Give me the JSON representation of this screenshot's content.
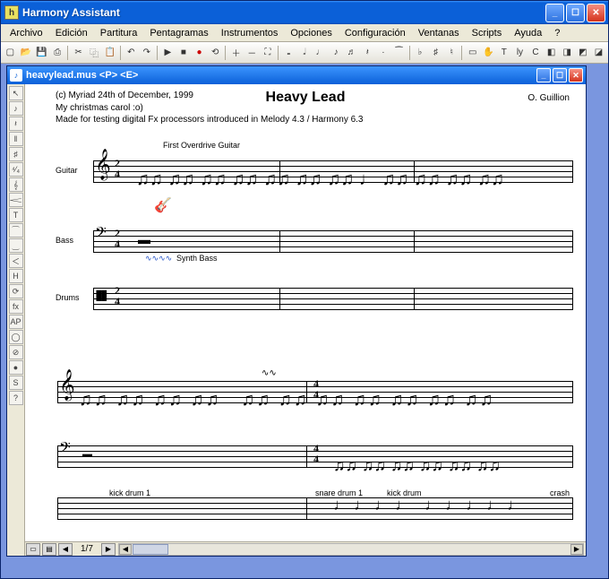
{
  "app": {
    "title": "Harmony Assistant",
    "icon_label": "h"
  },
  "menu": [
    "Archivo",
    "Edición",
    "Partitura",
    "Pentagramas",
    "Instrumentos",
    "Opciones",
    "Configuración",
    "Ventanas",
    "Scripts",
    "Ayuda",
    "?"
  ],
  "toolbar_icons": [
    "new",
    "open",
    "save",
    "print",
    "|",
    "cut",
    "copy",
    "paste",
    "|",
    "undo",
    "redo",
    "|",
    "play",
    "stop",
    "rec",
    "loop",
    "|",
    "zoom-in",
    "zoom-out",
    "fit",
    "|",
    "note-whole",
    "note-half",
    "note-quarter",
    "note-8th",
    "note-16th",
    "note-32nd",
    "rest",
    "dot",
    "tie",
    "|",
    "flat",
    "sharp",
    "natural",
    "|",
    "sel",
    "hand",
    "text",
    "lyrics",
    "chord",
    "|",
    "a",
    "b",
    "c",
    "d",
    "e"
  ],
  "palette_icons": [
    "arrow",
    "note",
    "rest",
    "bar",
    "key",
    "time",
    "clef",
    "dyn",
    "txt",
    "tie",
    "slur",
    "hair",
    "H",
    "rep",
    "fx",
    "AP",
    "loop",
    "mute",
    "rec",
    "S",
    "?"
  ],
  "document": {
    "title": "heavylead.mus  <P>  <E>",
    "icon_glyph": "♪"
  },
  "score": {
    "title": "Heavy Lead",
    "composer": "O. Guillion",
    "credit_line1": "(c) Myriad 24th of December, 1999",
    "credit_line2": "My christmas carol :o)",
    "credit_line3": "Made for testing digital Fx processors introduced in Melody 4.3 / Harmony 6.3",
    "annotation_guitar": "First Overdrive Guitar",
    "annotation_bass": "Synth Bass",
    "staves": [
      {
        "label": "Guitar",
        "clef": "𝄞",
        "time_top": "2",
        "time_bot": "4"
      },
      {
        "label": "Bass",
        "clef": "𝄢",
        "time_top": "2",
        "time_bot": "4"
      },
      {
        "label": "Drums",
        "clef": "||",
        "time_top": "2",
        "time_bot": "4"
      }
    ],
    "drum_labels": [
      "kick drum 1",
      "snare drum 1",
      "kick drum",
      "crash"
    ],
    "system2_time": {
      "top": "4",
      "bot": "4"
    }
  },
  "footer": {
    "page": "1/7"
  }
}
